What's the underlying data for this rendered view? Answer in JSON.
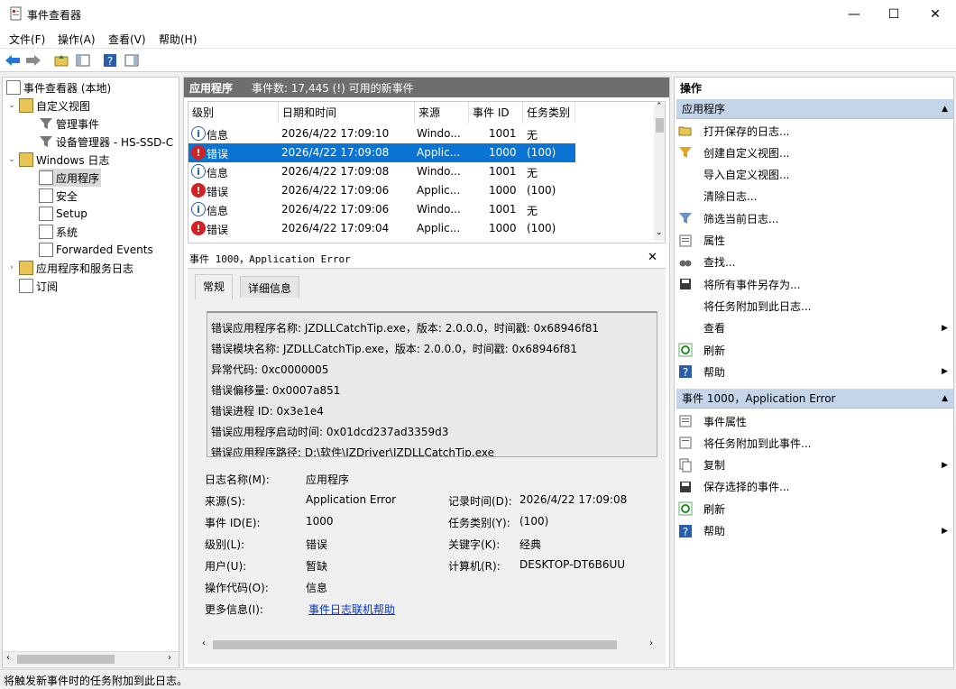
{
  "window": {
    "title": "事件查看器",
    "minimize": "—",
    "maximize": "☐",
    "close": "✕"
  },
  "menu": [
    "文件(F)",
    "操作(A)",
    "查看(V)",
    "帮助(H)"
  ],
  "tree": {
    "root": "事件查看器 (本地)",
    "custom_views": "自定义视图",
    "admin_events": "管理事件",
    "device_manager": "设备管理器 - HS-SSD-C",
    "windows_logs": "Windows 日志",
    "logs": [
      "应用程序",
      "安全",
      "Setup",
      "系统",
      "Forwarded Events"
    ],
    "app_service_logs": "应用程序和服务日志",
    "subscriptions": "订阅"
  },
  "center": {
    "title": "应用程序",
    "count": "事件数: 17,445 (!) 可用的新事件",
    "columns": [
      "级别",
      "日期和时间",
      "来源",
      "事件 ID",
      "任务类别"
    ],
    "rows": [
      {
        "level": "信息",
        "type": "info",
        "date": "2026/4/22 17:09:10",
        "source": "Windo...",
        "id": "1001",
        "task": "无"
      },
      {
        "level": "错误",
        "type": "err",
        "date": "2026/4/22 17:09:08",
        "source": "Applic...",
        "id": "1000",
        "task": "(100)"
      },
      {
        "level": "信息",
        "type": "info",
        "date": "2026/4/22 17:09:08",
        "source": "Windo...",
        "id": "1001",
        "task": "无"
      },
      {
        "level": "错误",
        "type": "err",
        "date": "2026/4/22 17:09:06",
        "source": "Applic...",
        "id": "1000",
        "task": "(100)"
      },
      {
        "level": "信息",
        "type": "info",
        "date": "2026/4/22 17:09:06",
        "source": "Windo...",
        "id": "1001",
        "task": "无"
      },
      {
        "level": "错误",
        "type": "err",
        "date": "2026/4/22 17:09:04",
        "source": "Applic...",
        "id": "1000",
        "task": "(100)"
      }
    ]
  },
  "detail": {
    "title": "事件 1000，Application Error",
    "close": "✕",
    "tabs": [
      "常规",
      "详细信息"
    ],
    "description": [
      "错误应用程序名称: JZDLLCatchTip.exe，版本: 2.0.0.0，时间戳: 0x68946f81",
      "错误模块名称: JZDLLCatchTip.exe，版本: 2.0.0.0，时间戳: 0x68946f81",
      "异常代码: 0xc0000005",
      "错误偏移量: 0x0007a851",
      "错误进程 ID: 0x3e1e4",
      "错误应用程序启动时间: 0x01dcd237ad3359d3",
      "错误应用程序路径: D:\\软件\\JZDriver\\JZDLLCatchTip.exe"
    ],
    "fields": {
      "log_name_label": "日志名称(M):",
      "log_name": "应用程序",
      "source_label": "来源(S):",
      "source": "Application Error",
      "logged_label": "记录时间(D):",
      "logged": "2026/4/22 17:09:08",
      "event_id_label": "事件 ID(E):",
      "event_id": "1000",
      "task_label": "任务类别(Y):",
      "task": "(100)",
      "level_label": "级别(L):",
      "level": "错误",
      "keywords_label": "关键字(K):",
      "keywords": "经典",
      "user_label": "用户(U):",
      "user": "暂缺",
      "computer_label": "计算机(R):",
      "computer": "DESKTOP-DT6B6UU",
      "opcode_label": "操作代码(O):",
      "opcode": "信息",
      "more_label": "更多信息(I):",
      "more_link": "事件日志联机帮助"
    }
  },
  "actions": {
    "title": "操作",
    "section1": "应用程序",
    "items1": [
      "打开保存的日志...",
      "创建自定义视图...",
      "导入自定义视图...",
      "清除日志...",
      "筛选当前日志...",
      "属性",
      "查找...",
      "将所有事件另存为...",
      "将任务附加到此日志...",
      "查看",
      "刷新",
      "帮助"
    ],
    "section2": "事件 1000，Application Error",
    "items2": [
      "事件属性",
      "将任务附加到此事件...",
      "复制",
      "保存选择的事件...",
      "刷新",
      "帮助"
    ]
  },
  "status": "将触发新事件时的任务附加到此日志。"
}
